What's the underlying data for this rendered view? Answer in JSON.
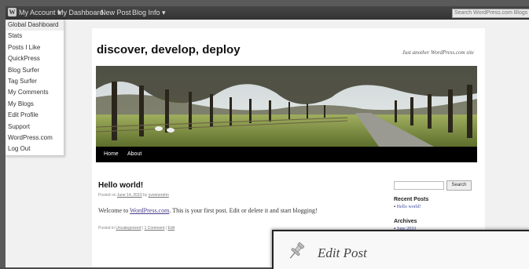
{
  "adminbar": {
    "logo": "W",
    "my_account": "My Account",
    "my_dashboard": "My Dashboard",
    "new_post": "New Post",
    "blog_info": "Blog Info",
    "search_placeholder": "Search WordPress.com Blogs"
  },
  "dropdown": {
    "items": [
      "Global Dashboard",
      "Stats",
      "Posts I Like",
      "QuickPress",
      "Blog Surfer",
      "Tag Surfer",
      "My Comments",
      "My Blogs",
      "Edit Profile",
      "Support",
      "WordPress.com",
      "Log Out"
    ]
  },
  "site": {
    "title": "discover, develop, deploy",
    "description": "Just another WordPress.com site"
  },
  "nav": {
    "home": "Home",
    "about": "About"
  },
  "post": {
    "title": "Hello world!",
    "posted_on": "Posted on",
    "date": "June 14, 2010",
    "by": "by",
    "author": "yvonnerehn",
    "body_before": "Welcome to ",
    "body_link": "WordPress.com",
    "body_after": ". This is your first post. Edit or delete it and start blogging!",
    "posted_in": "Posted in",
    "category": "Uncategorized",
    "sep1": " | ",
    "comments": "1 Comment",
    "sep2": " | ",
    "edit": "Edit"
  },
  "sidebar": {
    "search_button": "Search",
    "recent_posts_heading": "Recent Posts",
    "recent_post": "Hello world!",
    "archives_heading": "Archives",
    "archive": "June 2010"
  },
  "overlay": {
    "title": "Edit Post",
    "icon": "pushpin-icon"
  }
}
